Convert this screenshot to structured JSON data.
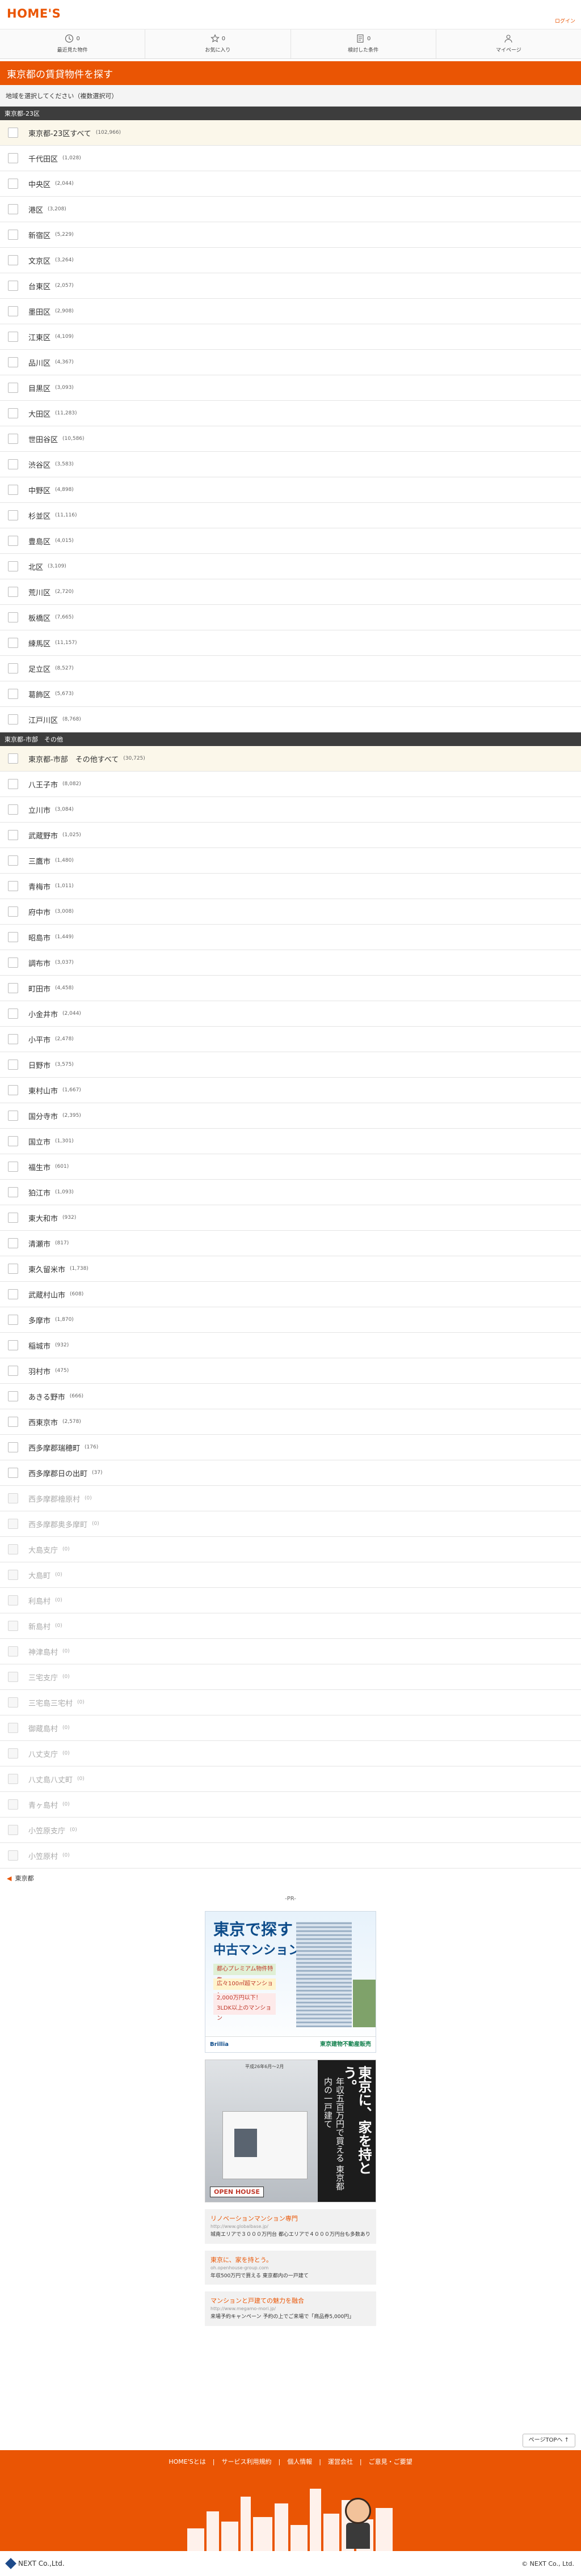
{
  "header": {
    "logo": "HOME'S",
    "link": "ログイン"
  },
  "nav": [
    {
      "icon": "clock-icon",
      "count": "0",
      "label": "最近見た物件"
    },
    {
      "icon": "star-icon",
      "count": "0",
      "label": "お気に入り"
    },
    {
      "icon": "document-icon",
      "count": "0",
      "label": "検討した条件"
    },
    {
      "icon": "person-icon",
      "count": "",
      "label": "マイページ"
    }
  ],
  "title": "東京都の賃貸物件を探す",
  "instruction": "地域を選択してください（複数選択可）",
  "section1": {
    "header": "東京都-23区",
    "all": {
      "name": "東京都-23区すべて",
      "count": "(102,966)"
    },
    "items": [
      {
        "name": "千代田区",
        "count": "(1,028)"
      },
      {
        "name": "中央区",
        "count": "(2,044)"
      },
      {
        "name": "港区",
        "count": "(3,208)"
      },
      {
        "name": "新宿区",
        "count": "(5,229)"
      },
      {
        "name": "文京区",
        "count": "(3,264)"
      },
      {
        "name": "台東区",
        "count": "(2,057)"
      },
      {
        "name": "墨田区",
        "count": "(2,908)"
      },
      {
        "name": "江東区",
        "count": "(4,109)"
      },
      {
        "name": "品川区",
        "count": "(4,367)"
      },
      {
        "name": "目黒区",
        "count": "(3,093)"
      },
      {
        "name": "大田区",
        "count": "(11,283)"
      },
      {
        "name": "世田谷区",
        "count": "(10,586)"
      },
      {
        "name": "渋谷区",
        "count": "(3,583)"
      },
      {
        "name": "中野区",
        "count": "(4,898)"
      },
      {
        "name": "杉並区",
        "count": "(11,116)"
      },
      {
        "name": "豊島区",
        "count": "(4,015)"
      },
      {
        "name": "北区",
        "count": "(3,109)"
      },
      {
        "name": "荒川区",
        "count": "(2,720)"
      },
      {
        "name": "板橋区",
        "count": "(7,665)"
      },
      {
        "name": "練馬区",
        "count": "(11,157)"
      },
      {
        "name": "足立区",
        "count": "(8,527)"
      },
      {
        "name": "葛飾区",
        "count": "(5,673)"
      },
      {
        "name": "江戸川区",
        "count": "(8,768)"
      }
    ]
  },
  "section2": {
    "header": "東京都-市部　その他",
    "all": {
      "name": "東京都-市部　その他すべて",
      "count": "(30,725)"
    },
    "items": [
      {
        "name": "八王子市",
        "count": "(8,082)",
        "disabled": false
      },
      {
        "name": "立川市",
        "count": "(3,084)",
        "disabled": false
      },
      {
        "name": "武蔵野市",
        "count": "(1,025)",
        "disabled": false
      },
      {
        "name": "三鷹市",
        "count": "(1,480)",
        "disabled": false
      },
      {
        "name": "青梅市",
        "count": "(1,011)",
        "disabled": false
      },
      {
        "name": "府中市",
        "count": "(3,008)",
        "disabled": false
      },
      {
        "name": "昭島市",
        "count": "(1,449)",
        "disabled": false
      },
      {
        "name": "調布市",
        "count": "(3,037)",
        "disabled": false
      },
      {
        "name": "町田市",
        "count": "(4,458)",
        "disabled": false
      },
      {
        "name": "小金井市",
        "count": "(2,044)",
        "disabled": false
      },
      {
        "name": "小平市",
        "count": "(2,478)",
        "disabled": false
      },
      {
        "name": "日野市",
        "count": "(3,575)",
        "disabled": false
      },
      {
        "name": "東村山市",
        "count": "(1,667)",
        "disabled": false
      },
      {
        "name": "国分寺市",
        "count": "(2,395)",
        "disabled": false
      },
      {
        "name": "国立市",
        "count": "(1,301)",
        "disabled": false
      },
      {
        "name": "福生市",
        "count": "(601)",
        "disabled": false
      },
      {
        "name": "狛江市",
        "count": "(1,093)",
        "disabled": false
      },
      {
        "name": "東大和市",
        "count": "(932)",
        "disabled": false
      },
      {
        "name": "清瀬市",
        "count": "(817)",
        "disabled": false
      },
      {
        "name": "東久留米市",
        "count": "(1,738)",
        "disabled": false
      },
      {
        "name": "武蔵村山市",
        "count": "(608)",
        "disabled": false
      },
      {
        "name": "多摩市",
        "count": "(1,870)",
        "disabled": false
      },
      {
        "name": "稲城市",
        "count": "(932)",
        "disabled": false
      },
      {
        "name": "羽村市",
        "count": "(475)",
        "disabled": false
      },
      {
        "name": "あきる野市",
        "count": "(666)",
        "disabled": false
      },
      {
        "name": "西東京市",
        "count": "(2,578)",
        "disabled": false
      },
      {
        "name": "西多摩郡瑞穂町",
        "count": "(176)",
        "disabled": false
      },
      {
        "name": "西多摩郡日の出町",
        "count": "(37)",
        "disabled": false
      },
      {
        "name": "西多摩郡檜原村",
        "count": "(0)",
        "disabled": true
      },
      {
        "name": "西多摩郡奥多摩町",
        "count": "(0)",
        "disabled": true
      },
      {
        "name": "大島支庁",
        "count": "(0)",
        "disabled": true
      },
      {
        "name": "大島町",
        "count": "(0)",
        "disabled": true
      },
      {
        "name": "利島村",
        "count": "(0)",
        "disabled": true
      },
      {
        "name": "新島村",
        "count": "(0)",
        "disabled": true
      },
      {
        "name": "神津島村",
        "count": "(0)",
        "disabled": true
      },
      {
        "name": "三宅支庁",
        "count": "(0)",
        "disabled": true
      },
      {
        "name": "三宅島三宅村",
        "count": "(0)",
        "disabled": true
      },
      {
        "name": "御蔵島村",
        "count": "(0)",
        "disabled": true
      },
      {
        "name": "八丈支庁",
        "count": "(0)",
        "disabled": true
      },
      {
        "name": "八丈島八丈町",
        "count": "(0)",
        "disabled": true
      },
      {
        "name": "青ヶ島村",
        "count": "(0)",
        "disabled": true
      },
      {
        "name": "小笠原支庁",
        "count": "(0)",
        "disabled": true
      },
      {
        "name": "小笠原村",
        "count": "(0)",
        "disabled": true
      }
    ]
  },
  "back_label": "東京都",
  "pr_label": "-PR-",
  "ad1": {
    "line1": "東京で探す",
    "line2": "中古マンション",
    "badge1": "都心プレミアム物件特集",
    "badge2": "広々100㎡超マンション",
    "badge3": "2,000万円以下！ 3LDK以上のマンション",
    "brand": "Brillia",
    "company": "東京建物不動産販売"
  },
  "ad2": {
    "small": "平成26年6月〜2月",
    "v1": "東京に、家を持とう。",
    "v2": "年収五百万円で買える 東京都内の一戸建て",
    "label": "OPEN HOUSE"
  },
  "text_ads": [
    {
      "title": "リノベーションマンション専門",
      "url": "http://www.globalbase.jp/",
      "desc": "城南エリアで３０００万円台 都心エリアで４０００万円台も多数あり"
    },
    {
      "title": "東京に、家を持とう。",
      "url": "oh.openhouse-group.com",
      "desc": "年収500万円で買える 東京都内の一戸建て"
    },
    {
      "title": "マンションと戸建ての魅力を融合",
      "url": "http://www.megamo-mori.jp/",
      "desc": "来場予約キャンペーン 予約の上でご来場で「商品券5,000円」"
    }
  ],
  "pagetop": "ページTOPへ ↑",
  "footer_links": [
    "HOME'Sとは",
    "サービス利用規約",
    "個人情報",
    "運営会社",
    "ご意見・ご要望"
  ],
  "bottom": {
    "company": "NEXT Co.,Ltd.",
    "copyright": "© NEXT Co., Ltd."
  }
}
